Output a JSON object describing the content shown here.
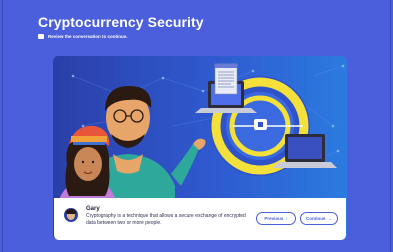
{
  "header": {
    "title": "Cryptocurrency Security",
    "subtitle": "Review the conversation to continue."
  },
  "dialog": {
    "speaker": "Gary",
    "message": "Cryptography is a technique that allows a secure exchange of encrypted data between two or more people."
  },
  "buttons": {
    "previous_label": "Previous",
    "previous_icon": "↑",
    "continue_label": "Continue",
    "continue_icon": "→"
  },
  "colors": {
    "page_bg": "#4b5fdc",
    "accent": "#4b5fdc",
    "highlight_ring": "#f3e03a"
  }
}
